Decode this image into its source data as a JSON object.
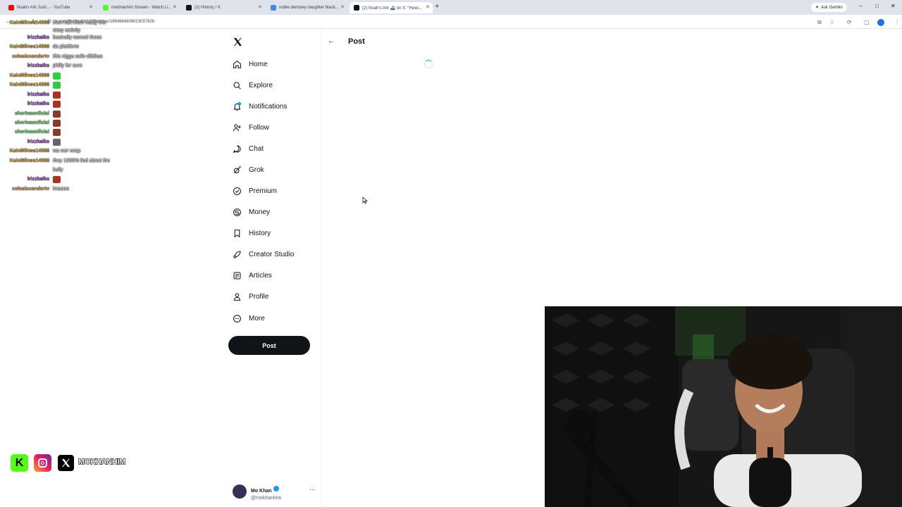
{
  "browser": {
    "tabs": [
      {
        "title": "Noahs Ark Justi... - YouTube",
        "fav": "#ff0000"
      },
      {
        "title": "mokhanhim Stream - Watch Li...",
        "fav": "#53fc18"
      },
      {
        "title": "(2) History / X",
        "fav": "#0f1419"
      },
      {
        "title": "noble demsley daughter black...",
        "fav": "#4285f4"
      },
      {
        "title": "(2) Noah's Ark 🚢 on X: \"Hewi...",
        "fav": "#0f1419"
      }
    ],
    "new_tab": "+",
    "gemini_label": "Ask Gemini",
    "url": "x.com/NoahsArk1000/status/1964984609023037626"
  },
  "chat": [
    {
      "user": "Kaini6lines14598",
      "msg": "then nah flosh ready tho",
      "color": "#c8a040"
    },
    {
      "user": "",
      "msg": "sissy activity",
      "color": "#9b59b6"
    },
    {
      "user": "lrizzkaiks",
      "msg": "basically named those",
      "color": "#9b59b6"
    },
    {
      "user": "Kaini6lines14598",
      "msg": "da plattform",
      "color": "#c8a040"
    },
    {
      "user": "colealexandertv",
      "msg": "this nigga sullo dibibas",
      "color": "#d4a25a"
    },
    {
      "user": "lrizzkaiks",
      "msg": "philly fer sure",
      "color": "#9b59b6"
    },
    {
      "user": "Kaini6lines14598",
      "msg": "",
      "color": "#c8a040",
      "emote": "#2ecc40"
    },
    {
      "user": "Kaini6lines14598",
      "msg": "",
      "color": "#c8a040",
      "emote": "#2ecc40"
    },
    {
      "user": "lrizzkaiks",
      "msg": "",
      "color": "#9b59b6",
      "emote": "#b03020"
    },
    {
      "user": "lrizzkaiks",
      "msg": "",
      "color": "#9b59b6",
      "emote": "#b03020"
    },
    {
      "user": "sherinasnficial",
      "msg": "",
      "color": "#7fd67f",
      "emote": "#8a3a2a"
    },
    {
      "user": "sherinasnficial",
      "msg": "",
      "color": "#7fd67f",
      "emote": "#8a3a2a"
    },
    {
      "user": "sherinasnficial",
      "msg": "",
      "color": "#7fd67f",
      "emote": "#8a3a2a"
    },
    {
      "user": "lrizzkaiks",
      "msg": "",
      "color": "#9b59b6",
      "emote": "#666666"
    },
    {
      "user": "Kaini6lines14598",
      "msg": "wa wer wrap",
      "color": "#c8a040"
    },
    {
      "user": "Kaini6lines14598",
      "msg": "they 1000% lied about the",
      "color": "#c8a040"
    },
    {
      "user": "",
      "msg": "bully",
      "color": "#c8a040"
    },
    {
      "user": "lrizzkaiks",
      "msg": "",
      "color": "#9b59b6",
      "emote": "#b03020"
    },
    {
      "user": "colealexandertv",
      "msg": "lmaooo",
      "color": "#d4a25a"
    }
  ],
  "sidebar": {
    "items": [
      {
        "label": "Home",
        "icon": "home-icon"
      },
      {
        "label": "Explore",
        "icon": "search-icon"
      },
      {
        "label": "Notifications",
        "icon": "bell-icon"
      },
      {
        "label": "Follow",
        "icon": "follow-icon"
      },
      {
        "label": "Chat",
        "icon": "chat-icon"
      },
      {
        "label": "Grok",
        "icon": "grok-icon"
      },
      {
        "label": "Premium",
        "icon": "premium-icon"
      },
      {
        "label": "Money",
        "icon": "money-icon"
      },
      {
        "label": "History",
        "icon": "bookmark-icon"
      },
      {
        "label": "Creator Studio",
        "icon": "rocket-icon"
      },
      {
        "label": "Articles",
        "icon": "articles-icon"
      },
      {
        "label": "Profile",
        "icon": "person-icon"
      },
      {
        "label": "More",
        "icon": "more-icon"
      }
    ],
    "post_label": "Post",
    "account": {
      "name": "Mo Khan",
      "handle": "@mokhanhim"
    }
  },
  "main": {
    "title": "Post"
  },
  "overlay": {
    "social_handle": "MOKHANHIM"
  },
  "colors": {
    "accent": "#1d9bf0",
    "kick": "#53fc18",
    "text": "#0f1419"
  }
}
